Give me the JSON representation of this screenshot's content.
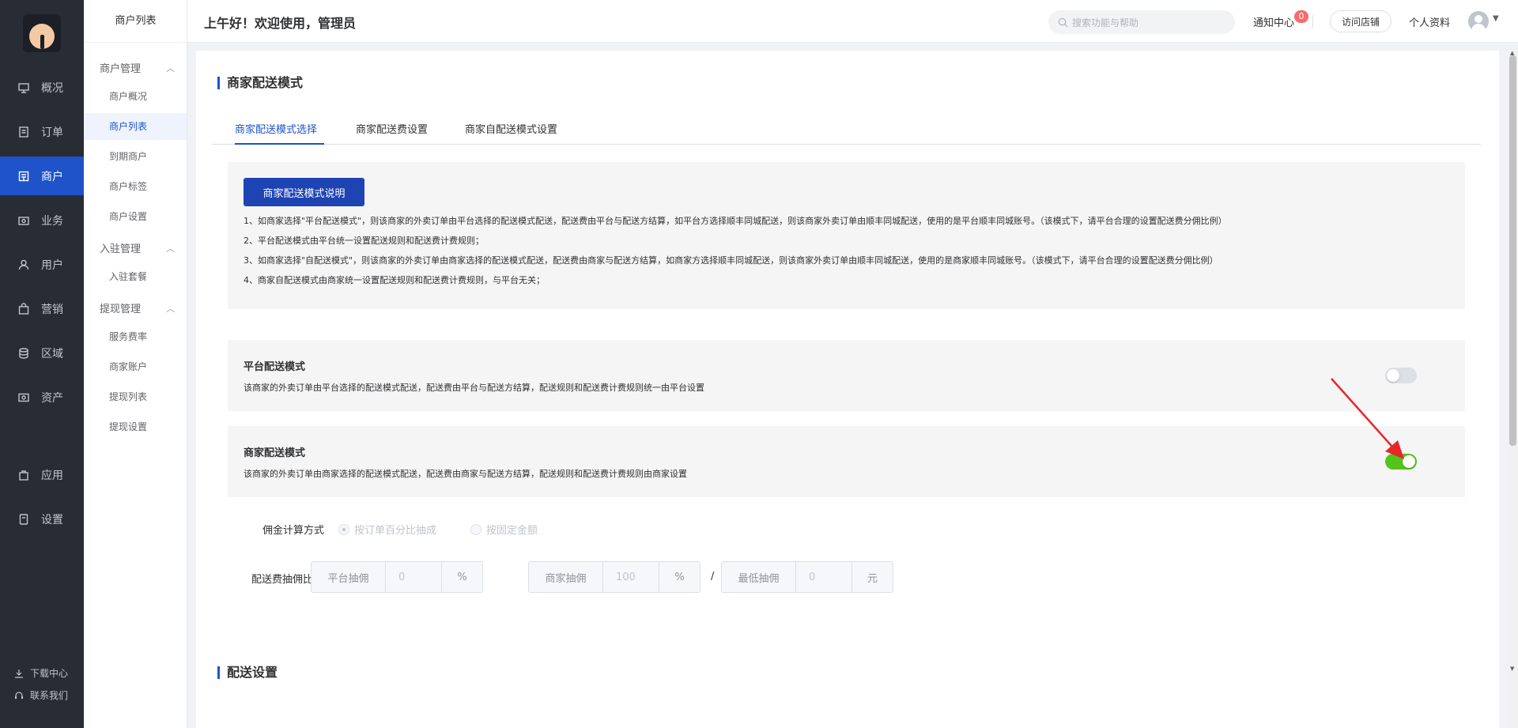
{
  "app": {
    "greeting": "上午好！欢迎使用，管理员"
  },
  "header": {
    "search_placeholder": "搜索功能与帮助",
    "notify_label": "通知中心",
    "notify_count": "0",
    "visit_store": "访问店铺",
    "profile": "个人资料"
  },
  "sidebar": {
    "items": [
      {
        "label": "概况",
        "icon": "monitor-icon"
      },
      {
        "label": "订单",
        "icon": "document-icon"
      },
      {
        "label": "商户",
        "icon": "store-icon"
      },
      {
        "label": "业务",
        "icon": "briefcase-icon"
      },
      {
        "label": "用户",
        "icon": "user-icon"
      },
      {
        "label": "营销",
        "icon": "bag-icon"
      },
      {
        "label": "区域",
        "icon": "database-icon"
      },
      {
        "label": "资产",
        "icon": "wallet-icon"
      },
      {
        "label": "应用",
        "icon": "app-icon"
      },
      {
        "label": "设置",
        "icon": "settings-icon"
      }
    ],
    "active_index": 2,
    "download": "下载中心",
    "contact": "联系我们"
  },
  "submenu": {
    "title": "商户列表",
    "groups": [
      {
        "label": "商户管理",
        "items": [
          "商户概况",
          "商户列表",
          "到期商户",
          "商户标签",
          "商户设置"
        ]
      },
      {
        "label": "入驻管理",
        "items": [
          "入驻套餐"
        ]
      },
      {
        "label": "提现管理",
        "items": [
          "服务费率",
          "商家账户",
          "提现列表",
          "提现设置"
        ]
      }
    ],
    "active_item": "商户列表"
  },
  "main": {
    "section_title": "商家配送模式",
    "tabs": [
      "商家配送模式选择",
      "商家配送费设置",
      "商家自配送模式设置"
    ],
    "active_tab": 0,
    "explain_button": "商家配送模式说明",
    "info_lines": [
      "1、如商家选择\"平台配送模式\"，则该商家的外卖订单由平台选择的配送模式配送，配送费由平台与配送方结算，如平台方选择顺丰同城配送，则该商家外卖订单由顺丰同城配送，使用的是平台顺丰同城账号。（该模式下，请平台合理的设置配送费分佣比例）",
      "2、平台配送模式由平台统一设置配送规则和配送费计费规则；",
      "3、如商家选择\"自配送模式\"，则该商家的外卖订单由商家选择的配送模式配送，配送费由商家与配送方结算，如商家方选择顺丰同城配送，则该商家外卖订单由顺丰同城配送，使用的是商家顺丰同城账号。（该模式下，请平台合理的设置配送费分佣比例）",
      "4、商家自配送模式由商家统一设置配送规则和配送费计费规则，与平台无关；"
    ],
    "modes": [
      {
        "title": "平台配送模式",
        "desc": "该商家的外卖订单由平台选择的配送模式配送，配送费由平台与配送方结算，配送规则和配送费计费规则统一由平台设置",
        "enabled": false
      },
      {
        "title": "商家配送模式",
        "desc": "该商家的外卖订单由商家选择的配送模式配送，配送费由商家与配送方结算，配送规则和配送费计费规则由商家设置",
        "enabled": true
      }
    ],
    "commission": {
      "label": "佣金计算方式",
      "options": [
        "按订单百分比抽成",
        "按固定金额"
      ],
      "selected": 0
    },
    "ratio": {
      "label": "配送费抽佣比例",
      "platform": {
        "prefix": "平台抽佣",
        "value": "0",
        "suffix": "%"
      },
      "merchant": {
        "prefix": "商家抽佣",
        "value": "100",
        "suffix": "%"
      },
      "separator": "/",
      "minimum": {
        "prefix": "最低抽佣",
        "value": "0",
        "suffix": "元"
      }
    },
    "section2_title": "配送设置"
  },
  "colors": {
    "primary": "#1e53c9",
    "sidebar_bg": "#282c34",
    "switch_on": "#52c41a",
    "annotation_arrow": "#e8262a"
  }
}
